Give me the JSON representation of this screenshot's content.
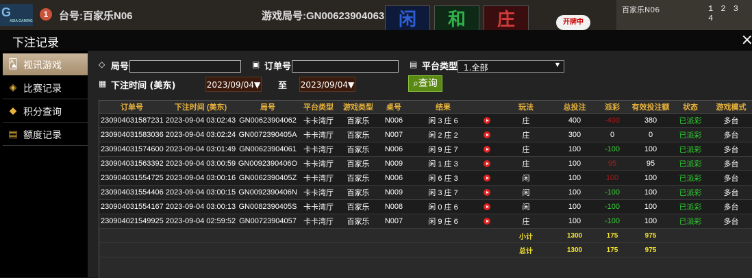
{
  "background": {
    "logo": "G",
    "logo_sub": "ASIA GAMING",
    "circle_num": "1",
    "table": "台号:百家乐N06",
    "round": "游戏局号:GN00623904063",
    "cells": [
      "闲",
      "和",
      "庄"
    ],
    "status_badge": "开牌中",
    "right_label": "百家乐N06",
    "right_nums": "1 2 3 4"
  },
  "modal": {
    "title": "下注记录",
    "close": "×"
  },
  "sidebar": {
    "items": [
      {
        "label": "视讯游戏",
        "icon": "playing-cards-icon",
        "glyph": "🂡"
      },
      {
        "label": "比赛记录",
        "icon": "tag-icon",
        "glyph": "◈"
      },
      {
        "label": "积分查询",
        "icon": "diamond-icon",
        "glyph": "◆"
      },
      {
        "label": "额度记录",
        "icon": "document-icon",
        "glyph": "▤"
      }
    ]
  },
  "filters": {
    "round_label": "局号",
    "round_value": "",
    "order_label": "订单号",
    "order_value": "",
    "platform_label": "平台类型",
    "platform_value": "1.全部",
    "time_label": "下注时间 (美东)",
    "date_from": "2023/09/04▼",
    "to_label": "至",
    "date_to": "2023/09/04▼",
    "query_label": "查询"
  },
  "table": {
    "headers": [
      "订单号",
      "下注时间 (美东)",
      "局号",
      "平台类型",
      "游戏类型",
      "桌号",
      "结果",
      "",
      "玩法",
      "总投注",
      "派彩",
      "有效投注额",
      "状态",
      "游戏模式"
    ],
    "rows": [
      [
        "230904031587231",
        "2023-09-04 03:02:43",
        "GN00623904062",
        "卡卡湾厅",
        "百家乐",
        "N006",
        "闲 3 庄 6",
        "",
        "庄",
        "400",
        "-400",
        "380",
        "已派彩",
        "多台"
      ],
      [
        "230904031583036",
        "2023-09-04 03:02:24",
        "GN0072390405A",
        "卡卡湾厅",
        "百家乐",
        "N007",
        "闲 2 庄 2",
        "",
        "庄",
        "300",
        "0",
        "0",
        "已派彩",
        "多台"
      ],
      [
        "230904031574600",
        "2023-09-04 03:01:49",
        "GN00623904061",
        "卡卡湾厅",
        "百家乐",
        "N006",
        "闲 9 庄 7",
        "",
        "庄",
        "100",
        "-100",
        "100",
        "已派彩",
        "多台"
      ],
      [
        "230904031563392",
        "2023-09-04 03:00:59",
        "GN0092390406O",
        "卡卡湾厅",
        "百家乐",
        "N009",
        "闲 1 庄 3",
        "",
        "庄",
        "100",
        "95",
        "95",
        "已派彩",
        "多台"
      ],
      [
        "230904031554725",
        "2023-09-04 03:00:16",
        "GN0062390405Z",
        "卡卡湾厅",
        "百家乐",
        "N006",
        "闲 6 庄 3",
        "",
        "闲",
        "100",
        "100",
        "100",
        "已派彩",
        "多台"
      ],
      [
        "230904031554406",
        "2023-09-04 03:00:15",
        "GN0092390406N",
        "卡卡湾厅",
        "百家乐",
        "N009",
        "闲 3 庄 7",
        "",
        "闲",
        "100",
        "-100",
        "100",
        "已派彩",
        "多台"
      ],
      [
        "230904031554167",
        "2023-09-04 03:00:13",
        "GN0082390405S",
        "卡卡湾厅",
        "百家乐",
        "N008",
        "闲 0 庄 6",
        "",
        "闲",
        "100",
        "-100",
        "100",
        "已派彩",
        "多台"
      ],
      [
        "230904021549925",
        "2023-09-04 02:59:52",
        "GN00723904057",
        "卡卡湾厅",
        "百家乐",
        "N007",
        "闲 9 庄 6",
        "",
        "庄",
        "100",
        "-100",
        "100",
        "已派彩",
        "多台"
      ]
    ],
    "row_styles": [
      {
        "payout": "red"
      },
      {
        "payout": ""
      },
      {
        "payout": "neg"
      },
      {
        "payout": "red"
      },
      {
        "payout": "red"
      },
      {
        "payout": "neg"
      },
      {
        "payout": "neg"
      },
      {
        "payout": "neg"
      }
    ],
    "subtotal": {
      "label": "小计",
      "bet": "1300",
      "payout": "175",
      "valid": "975"
    },
    "total": {
      "label": "总计",
      "bet": "1300",
      "payout": "175",
      "valid": "975"
    }
  }
}
